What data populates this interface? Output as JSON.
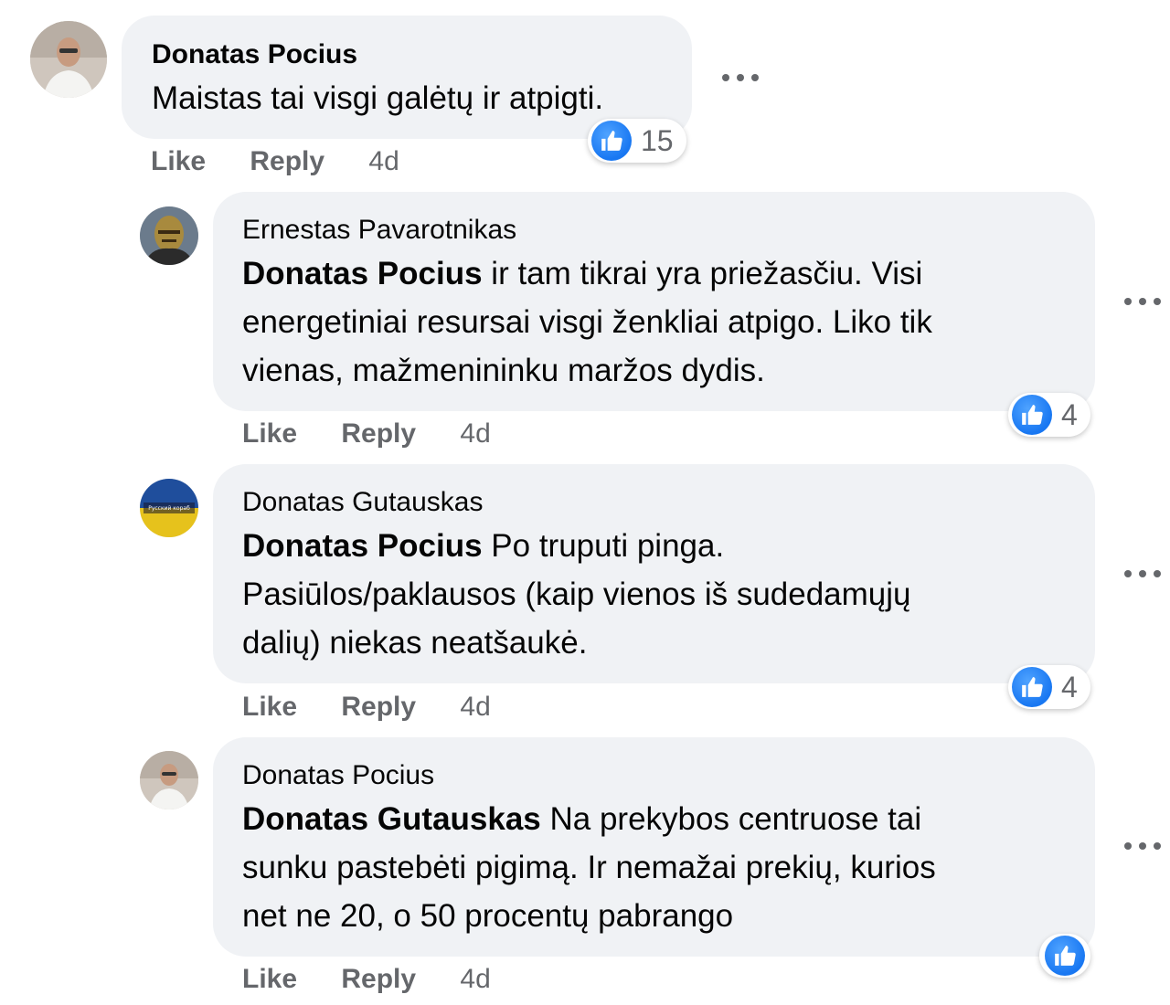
{
  "comments": [
    {
      "author": "Donatas Pocius",
      "mention": "",
      "text": "Maistas tai visgi galėtų ir atpigti.",
      "like_label": "Like",
      "reply_label": "Reply",
      "time": "4d",
      "reaction_count": "15"
    },
    {
      "author": "Ernestas Pavarotnikas",
      "mention": "Donatas Pocius",
      "text_line1": " ir tam tikrai yra priežasčiu. Visi",
      "text_line2": "energetiniai resursai visgi ženkliai atpigo. Liko tik",
      "text_line3": "vienas, mažmenininku maržos dydis.",
      "like_label": "Like",
      "reply_label": "Reply",
      "time": "4d",
      "reaction_count": "4"
    },
    {
      "author": "Donatas Gutauskas",
      "mention": "Donatas Pocius",
      "text_line1": " Po truputi pinga.",
      "text_line2": "Pasiūlos/paklausos (kaip vienos iš sudedamųjų",
      "text_line3": "dalių) niekas neatšaukė.",
      "avatar_text": "Русский кораб",
      "like_label": "Like",
      "reply_label": "Reply",
      "time": "4d",
      "reaction_count": "4"
    },
    {
      "author": "Donatas Pocius",
      "mention": "Donatas Gutauskas",
      "text_line1": " Na prekybos centruose tai",
      "text_line2": "sunku pastebėti pigimą. Ir nemažai prekių, kurios",
      "text_line3": "net ne 20, o 50 procentų pabrango",
      "like_label": "Like",
      "reply_label": "Reply",
      "time": "4d",
      "reaction_count": ""
    }
  ],
  "colors": {
    "bubble": "#f0f2f5",
    "meta_text": "#65676b",
    "like_blue": "#1877f2"
  },
  "icons": [
    "like-icon",
    "more-options-icon"
  ]
}
